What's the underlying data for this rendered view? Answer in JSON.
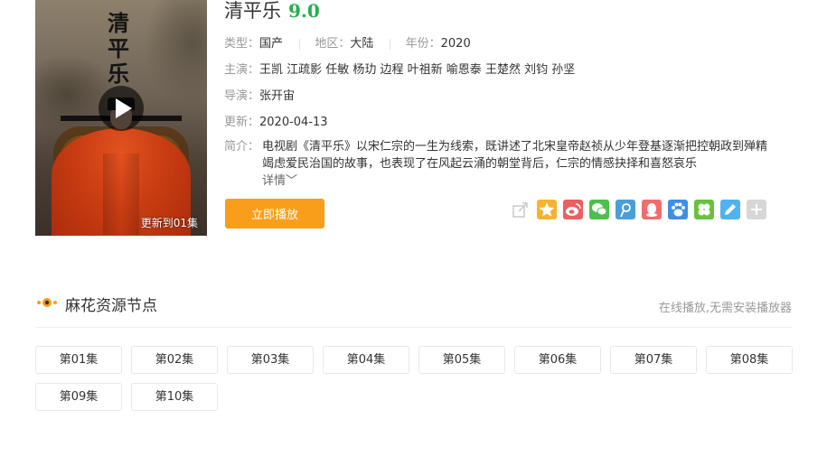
{
  "movie": {
    "title": "清平乐",
    "score": "9.0",
    "poster_calligraphy": "清平乐",
    "poster_update_label": "更新到01集",
    "type_label": "类型：",
    "type_value": "国产",
    "region_label": "地区：",
    "region_value": "大陆",
    "year_label": "年份：",
    "year_value": "2020",
    "cast_label": "主演：",
    "cast_value": "王凯 江疏影 任敏 杨玏 边程 叶祖新 喻恩泰 王楚然 刘钧 孙坚",
    "director_label": "导演：",
    "director_value": "张开宙",
    "updated_label": "更新：",
    "updated_value": "2020-04-13",
    "intro_label": "简介：",
    "intro_text": "电视剧《清平乐》以宋仁宗的一生为线索，既讲述了北宋皇帝赵祯从少年登基逐渐把控朝政到殚精竭虑爱民治国的故事，也表现了在风起云涌的朝堂背后，仁宗的情感抉择和喜怒哀乐",
    "intro_more": "详情﹀",
    "play_button": "立即播放"
  },
  "share": {
    "icons": [
      {
        "name": "share-icon",
        "color": "#d0d0d0"
      },
      {
        "name": "qzone-icon",
        "color": "#fbb12b"
      },
      {
        "name": "weibo-icon",
        "color": "#ee5f5f"
      },
      {
        "name": "wechat-icon",
        "color": "#4bc14b"
      },
      {
        "name": "tencent-weibo-icon",
        "color": "#4a9fd8"
      },
      {
        "name": "qq-icon",
        "color": "#f26c6c"
      },
      {
        "name": "baidu-icon",
        "color": "#3d8fe6"
      },
      {
        "name": "clover-icon",
        "color": "#67c23a"
      },
      {
        "name": "pencil-icon",
        "color": "#4fb2f3"
      },
      {
        "name": "more-icon",
        "color": "#d7d7d7"
      }
    ]
  },
  "section": {
    "title": "麻花资源节点",
    "note": "在线播放,无需安装播放器"
  },
  "episodes": [
    "第01集",
    "第02集",
    "第03集",
    "第04集",
    "第05集",
    "第06集",
    "第07集",
    "第08集",
    "第09集",
    "第10集"
  ]
}
